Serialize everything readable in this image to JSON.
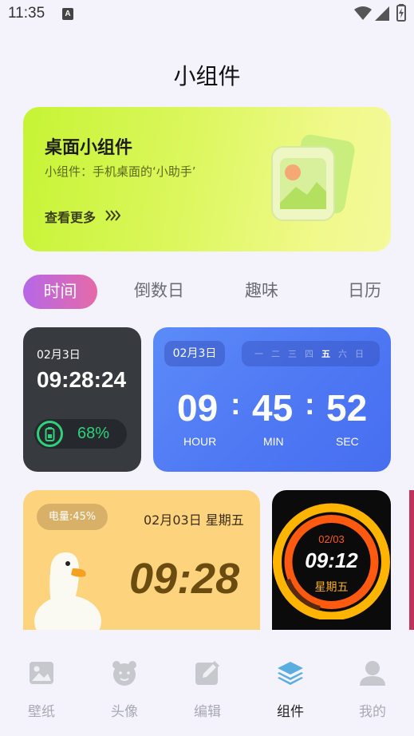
{
  "status_bar": {
    "time": "11:35",
    "notif_icon": "A"
  },
  "page_title": "小组件",
  "banner": {
    "title": "桌面小组件",
    "subtitle": "小组件：手机桌面的‘小助手’",
    "more_label": "查看更多"
  },
  "tabs": [
    {
      "label": "时间",
      "active": true
    },
    {
      "label": "倒数日",
      "active": false
    },
    {
      "label": "趣味",
      "active": false
    },
    {
      "label": "日历",
      "active": false
    }
  ],
  "widgets": {
    "clock_dark": {
      "date": "02月3日",
      "time": "09:28:24",
      "battery": "68%"
    },
    "clock_blue": {
      "date": "02月3日",
      "weekdays": [
        "一",
        "二",
        "三",
        "四",
        "五",
        "六",
        "日"
      ],
      "active_weekday": "五",
      "hours": "09",
      "minutes": "45",
      "seconds": "52",
      "hour_label": "HOUR",
      "min_label": "MIN",
      "sec_label": "SEC"
    },
    "duck": {
      "battery": "电量:45%",
      "date": "02月03日 星期五",
      "time": "09:28"
    },
    "ring": {
      "date": "02/03",
      "time": "09:12",
      "day": "星期五"
    }
  },
  "bottom_nav": [
    {
      "label": "壁纸",
      "icon": "image-icon",
      "active": false
    },
    {
      "label": "头像",
      "icon": "bear-face-icon",
      "active": false
    },
    {
      "label": "编辑",
      "icon": "edit-icon",
      "active": false
    },
    {
      "label": "组件",
      "icon": "layers-icon",
      "active": true
    },
    {
      "label": "我的",
      "icon": "user-icon",
      "active": false
    }
  ],
  "colors": {
    "background": "#f4f3fc",
    "tab_active_start": "#b667e8",
    "tab_active_end": "#e56aa7",
    "battery_green": "#2fd27a",
    "nav_active": "#5aaedf"
  }
}
